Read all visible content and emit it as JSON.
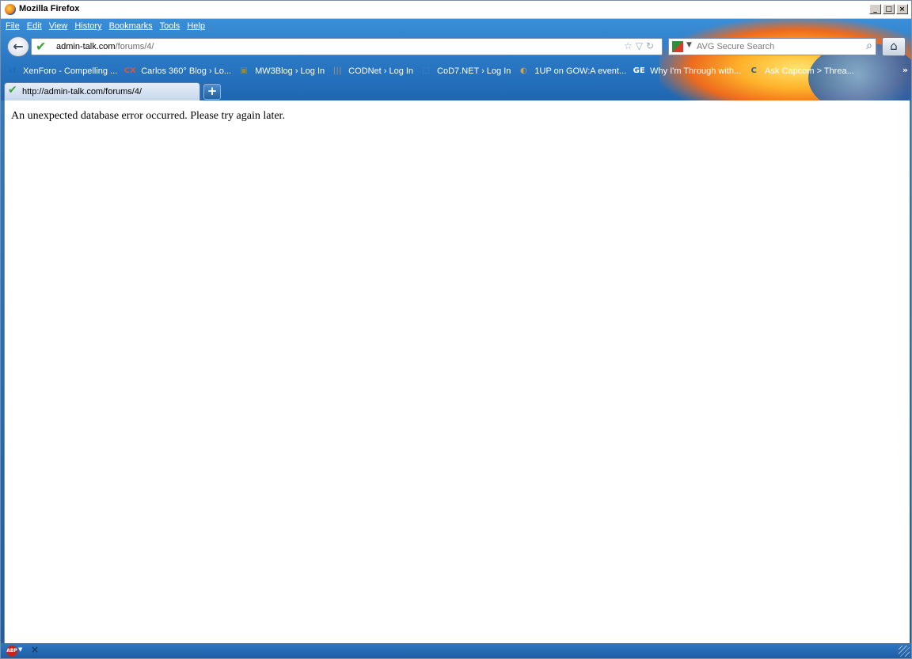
{
  "window": {
    "title": "Mozilla Firefox",
    "minimize": "_",
    "maximize": "□",
    "close": "×"
  },
  "menu": [
    "File",
    "Edit",
    "View",
    "History",
    "Bookmarks",
    "Tools",
    "Help"
  ],
  "nav": {
    "url_domain": "admin-talk.com",
    "url_path": "/forums/4/",
    "search_placeholder": "AVG Secure Search",
    "search_engine_icon": "avg-icon"
  },
  "bookmarks": [
    {
      "label": "XenForo - Compelling ...",
      "icon": "xf",
      "color": "#1f6fb8"
    },
    {
      "label": "Carlos 360° Blog › Lo...",
      "icon": "CX",
      "color": "#e0542a"
    },
    {
      "label": "MW3Blog › Log In",
      "icon": "▣",
      "color": "#9a8a2a"
    },
    {
      "label": "CODNet › Log In",
      "icon": "|||",
      "color": "#8a8a8a"
    },
    {
      "label": "CoD7.NET › Log In",
      "icon": "⬚",
      "color": "#4f86c2"
    },
    {
      "label": "1UP on GOW:A event...",
      "icon": "◐",
      "color": "#d9a34a"
    },
    {
      "label": "Why I'm Through with...",
      "icon": "GE",
      "color": "#ffffff"
    },
    {
      "label": "Ask Capcom > Threa...",
      "icon": "C",
      "color": "#2a5fa8"
    }
  ],
  "tab": {
    "title": "http://admin-talk.com/forums/4/"
  },
  "page": {
    "message": "An unexpected database error occurred. Please try again later."
  },
  "status": {
    "abp": "ABP"
  }
}
